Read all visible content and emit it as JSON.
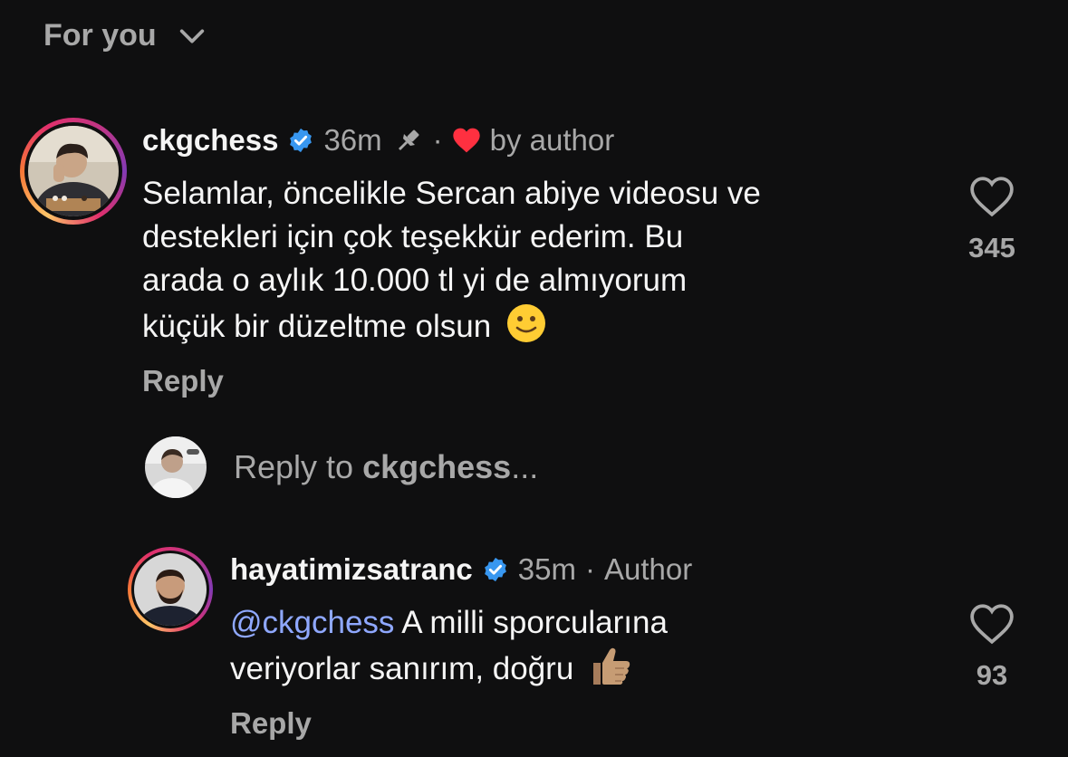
{
  "filter": {
    "label": "For you"
  },
  "comments": [
    {
      "username": "ckgchess",
      "time": "36m",
      "liked_by": "by author",
      "text_lines": [
        "Selamlar, öncelikle Sercan abiye videosu ve",
        "destekleri için çok teşekkür ederim. Bu",
        "arada o aylık 10.000 tl yi de almıyorum",
        "küçük bir düzeltme olsun"
      ],
      "emoji": "slightly-smiling-face",
      "likes": "345",
      "reply_label": "Reply"
    },
    {
      "username": "hayatimizsatranc",
      "time": "35m",
      "badge": "Author",
      "mention": "@ckgchess",
      "text_lines": [
        "A milli sporcularına",
        "veriyorlar sanırım, doğru"
      ],
      "emoji": "thumbs-up-medium-skin",
      "likes": "93",
      "reply_label": "Reply"
    }
  ],
  "reply_box": {
    "prefix": "Reply to",
    "target": "ckgchess",
    "suffix": "..."
  },
  "colors": {
    "background": "#0f0f10",
    "text": "#f5f5f5",
    "muted": "#a8a8a8",
    "mention": "#8fa8ff",
    "verified": "#3897f0",
    "like_red": "#ff3040"
  }
}
